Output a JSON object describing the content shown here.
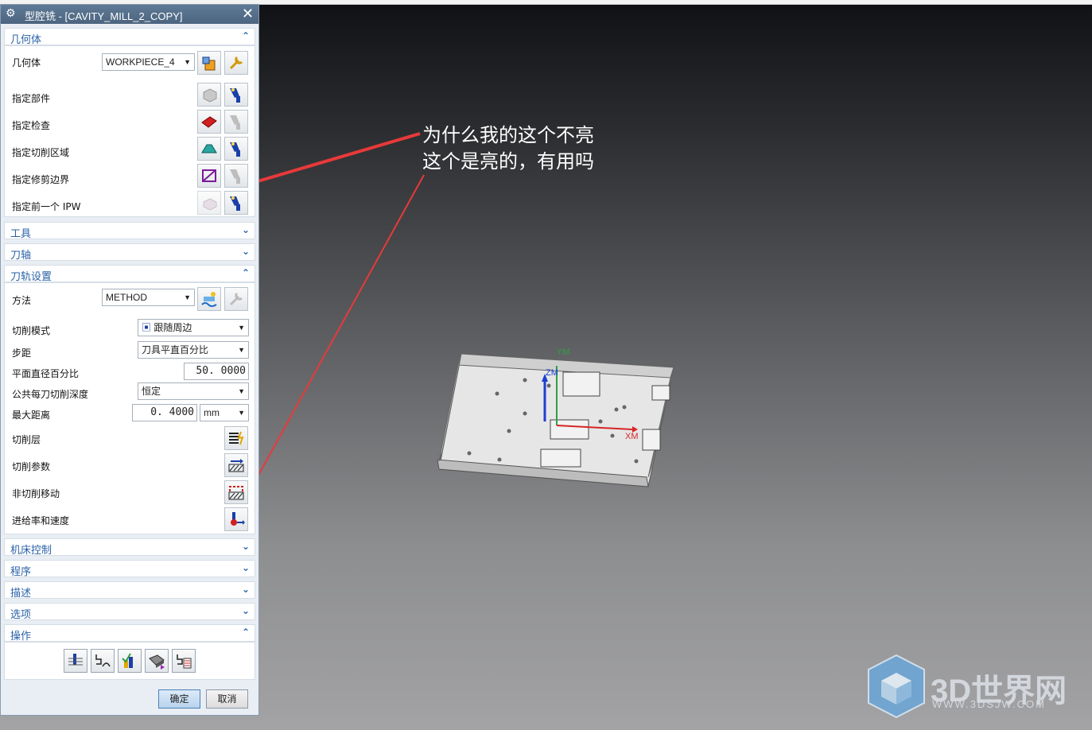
{
  "dialog": {
    "title": "型腔铣 - [CAVITY_MILL_2_COPY]",
    "close_icon": "close-icon",
    "sections": {
      "geometry": "几何体",
      "tool": "工具",
      "tool_axis": "刀轴",
      "path_settings": "刀轨设置",
      "machine_control": "机床控制",
      "program": "程序",
      "description": "描述",
      "options": "选项",
      "actions": "操作"
    },
    "geometry": {
      "geometry_label": "几何体",
      "geometry_value": "WORKPIECE_4",
      "specify_part": "指定部件",
      "specify_check": "指定检查",
      "specify_cut_area": "指定切削区域",
      "specify_trim_boundary": "指定修剪边界",
      "specify_prev_ipw": "指定前一个 IPW"
    },
    "path_settings": {
      "method_label": "方法",
      "method_value": "METHOD",
      "cut_pattern_label": "切削模式",
      "cut_pattern_value": "跟随周边",
      "stepover_label": "步距",
      "stepover_value": "刀具平直百分比",
      "flat_diameter_percent_label": "平面直径百分比",
      "flat_diameter_percent_value": "50. 0000",
      "common_depth_label": "公共每刀切削深度",
      "common_depth_value": "恒定",
      "max_distance_label": "最大距离",
      "max_distance_value": "0. 4000",
      "max_distance_unit": "mm",
      "cut_levels_label": "切削层",
      "cut_params_label": "切削参数",
      "non_cutting_moves_label": "非切削移动",
      "feeds_speeds_label": "进给率和速度"
    },
    "buttons": {
      "ok": "确定",
      "cancel": "取消"
    }
  },
  "annotation": {
    "line1": "为什么我的这个不亮",
    "line2": "这个是亮的，有用吗",
    "arrow_color": "#e8393a"
  },
  "viewport": {
    "axis_x": "XM",
    "axis_y": "YM",
    "axis_z": "ZM"
  },
  "watermark": {
    "text": "3D世界网",
    "url": "WWW.3DSJW.COM"
  },
  "colors": {
    "accent": "#2a62a8",
    "title_bar": "#4f6983",
    "ok_button": "#c9def3"
  }
}
